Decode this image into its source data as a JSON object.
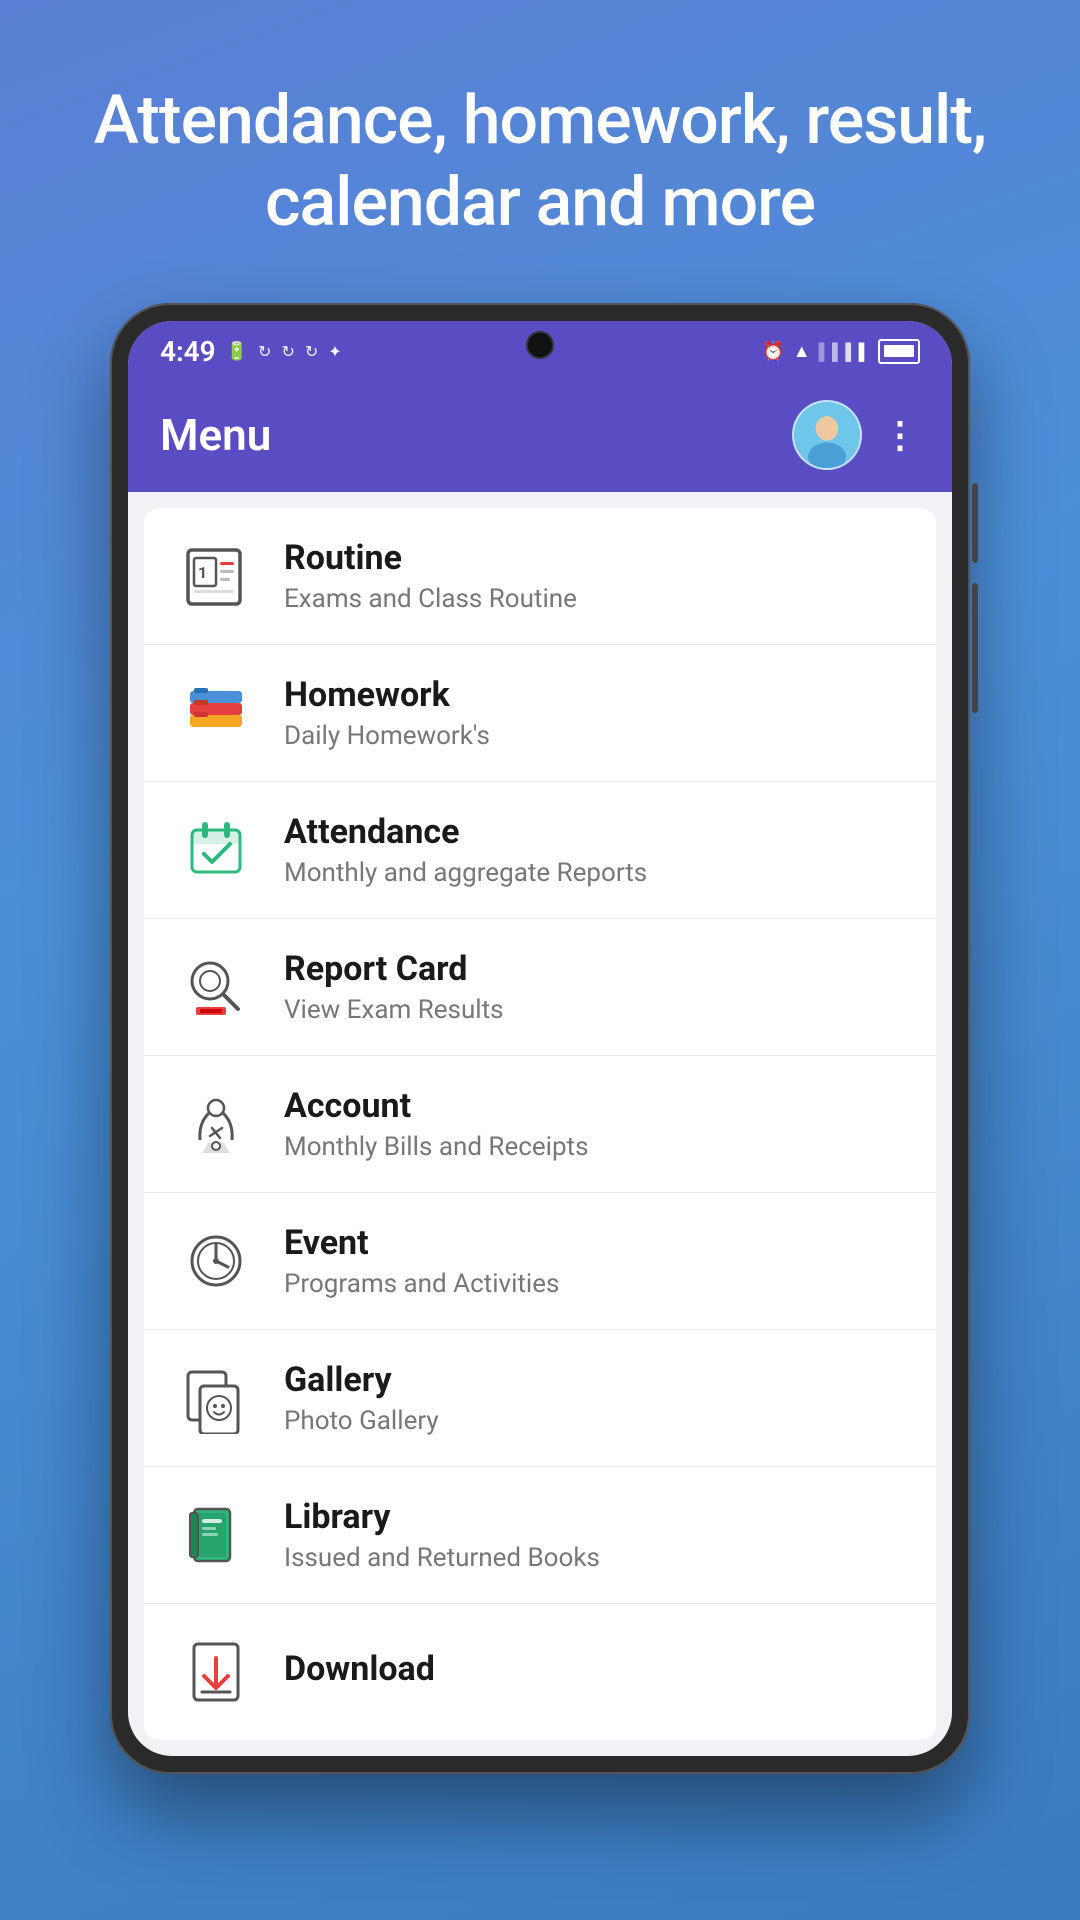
{
  "hero": {
    "title": "Attendance, homework, result, calendar and more"
  },
  "status_bar": {
    "time": "4:49",
    "icons_left": [
      "battery-charging",
      "refresh1",
      "refresh2",
      "refresh3",
      "slack"
    ]
  },
  "app_header": {
    "title": "Menu",
    "more_label": "⋮"
  },
  "menu_items": [
    {
      "id": "routine",
      "title": "Routine",
      "subtitle": "Exams and Class Routine",
      "icon": "routine"
    },
    {
      "id": "homework",
      "title": "Homework",
      "subtitle": "Daily Homework's",
      "icon": "homework"
    },
    {
      "id": "attendance",
      "title": "Attendance",
      "subtitle": "Monthly and aggregate Reports",
      "icon": "attendance"
    },
    {
      "id": "report-card",
      "title": "Report Card",
      "subtitle": "View Exam Results",
      "icon": "report"
    },
    {
      "id": "account",
      "title": "Account",
      "subtitle": "Monthly Bills and Receipts",
      "icon": "account"
    },
    {
      "id": "event",
      "title": "Event",
      "subtitle": "Programs and Activities",
      "icon": "event"
    },
    {
      "id": "gallery",
      "title": "Gallery",
      "subtitle": "Photo Gallery",
      "icon": "gallery"
    },
    {
      "id": "library",
      "title": "Library",
      "subtitle": "Issued and Returned Books",
      "icon": "library"
    },
    {
      "id": "download",
      "title": "Download",
      "subtitle": "",
      "icon": "download"
    }
  ]
}
